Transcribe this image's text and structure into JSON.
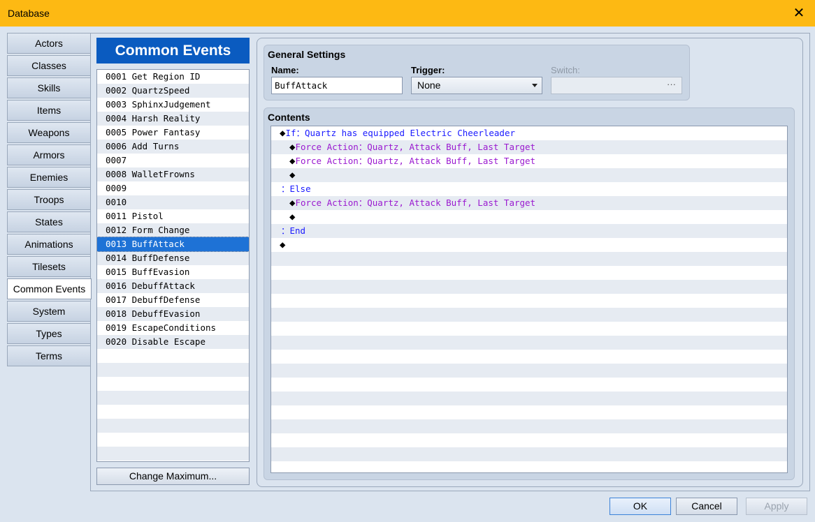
{
  "window": {
    "title": "Database",
    "close_glyph": "✕"
  },
  "tabs": [
    {
      "label": "Actors",
      "active": false
    },
    {
      "label": "Classes",
      "active": false
    },
    {
      "label": "Skills",
      "active": false
    },
    {
      "label": "Items",
      "active": false
    },
    {
      "label": "Weapons",
      "active": false
    },
    {
      "label": "Armors",
      "active": false
    },
    {
      "label": "Enemies",
      "active": false
    },
    {
      "label": "Troops",
      "active": false
    },
    {
      "label": "States",
      "active": false
    },
    {
      "label": "Animations",
      "active": false
    },
    {
      "label": "Tilesets",
      "active": false
    },
    {
      "label": "Common Events",
      "active": true
    },
    {
      "label": "System",
      "active": false
    },
    {
      "label": "Types",
      "active": false
    },
    {
      "label": "Terms",
      "active": false
    }
  ],
  "common_events": {
    "header": "Common Events",
    "selected_index": 12,
    "items": [
      "0001 Get Region ID",
      "0002 QuartzSpeed",
      "0003 SphinxJudgement",
      "0004 Harsh Reality",
      "0005 Power Fantasy",
      "0006 Add Turns",
      "0007",
      "0008 WalletFrowns",
      "0009",
      "0010",
      "0011 Pistol",
      "0012 Form Change",
      "0013 BuffAttack",
      "0014 BuffDefense",
      "0015 BuffEvasion",
      "0016 DebuffAttack",
      "0017 DebuffDefense",
      "0018 DebuffEvasion",
      "0019 EscapeConditions",
      "0020 Disable Escape"
    ],
    "change_max_label": "Change Maximum..."
  },
  "general_settings": {
    "title": "General Settings",
    "name_label": "Name:",
    "name_value": "BuffAttack",
    "trigger_label": "Trigger:",
    "trigger_value": "None",
    "switch_label": "Switch:",
    "switch_button": "···"
  },
  "contents": {
    "title": "Contents",
    "lines": [
      {
        "indent": 0,
        "diamond": true,
        "segments": [
          {
            "text": "If：Quartz has equipped Electric Cheerleader",
            "color": "blue"
          }
        ]
      },
      {
        "indent": 1,
        "diamond": true,
        "segments": [
          {
            "text": "Force Action：",
            "color": "purple"
          },
          {
            "text": "Quartz, Attack Buff, Last Target",
            "color": "purple"
          }
        ]
      },
      {
        "indent": 1,
        "diamond": true,
        "segments": [
          {
            "text": "Force Action：",
            "color": "purple"
          },
          {
            "text": "Quartz, Attack Buff, Last Target",
            "color": "purple"
          }
        ]
      },
      {
        "indent": 1,
        "diamond": true,
        "segments": []
      },
      {
        "indent": 0,
        "diamond": false,
        "segments": [
          {
            "text": "：Else",
            "color": "blue"
          }
        ]
      },
      {
        "indent": 1,
        "diamond": true,
        "segments": [
          {
            "text": "Force Action：",
            "color": "purple"
          },
          {
            "text": "Quartz, Attack Buff, Last Target",
            "color": "purple"
          }
        ]
      },
      {
        "indent": 1,
        "diamond": true,
        "segments": []
      },
      {
        "indent": 0,
        "diamond": false,
        "segments": [
          {
            "text": "：End",
            "color": "blue"
          }
        ]
      },
      {
        "indent": 0,
        "diamond": true,
        "segments": []
      }
    ]
  },
  "footer": {
    "ok_label": "OK",
    "cancel_label": "Cancel",
    "apply_label": "Apply"
  }
}
